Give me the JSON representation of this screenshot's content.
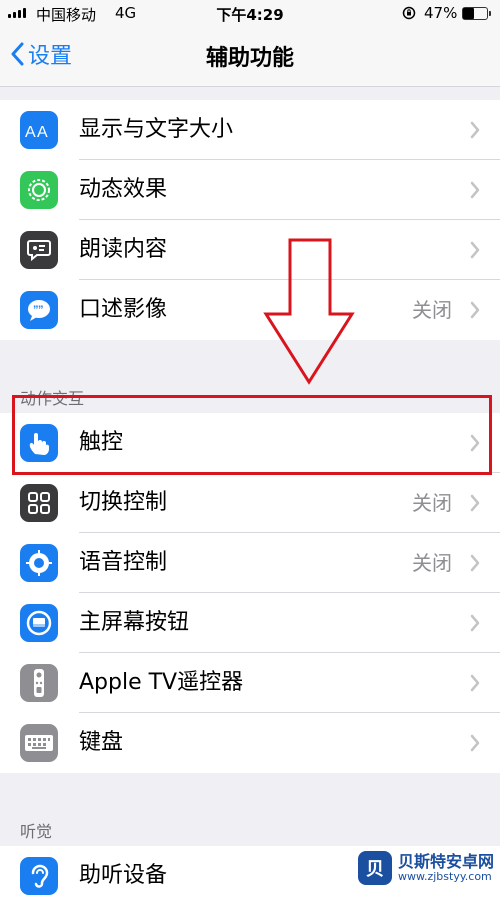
{
  "status_bar": {
    "carrier": "中国移动",
    "network": "4G",
    "time": "下午4:29",
    "battery": "47%",
    "battery_level": 0.47
  },
  "nav": {
    "back_label": "设置",
    "title": "辅助功能"
  },
  "vision": {
    "items": [
      {
        "label": "显示与文字大小",
        "value": "",
        "icon": "text-size-icon",
        "color": "#1a7ef0"
      },
      {
        "label": "动态效果",
        "value": "",
        "icon": "motion-icon",
        "color": "#33c759"
      },
      {
        "label": "朗读内容",
        "value": "",
        "icon": "spoken-content-icon",
        "color": "#3a3a3c"
      },
      {
        "label": "口述影像",
        "value": "关闭",
        "icon": "audio-description-icon",
        "color": "#1a7ef0"
      }
    ]
  },
  "interaction": {
    "header": "动作交互",
    "items": [
      {
        "label": "触控",
        "value": "",
        "icon": "touch-icon",
        "color": "#1a7ef0"
      },
      {
        "label": "切换控制",
        "value": "关闭",
        "icon": "switch-control-icon",
        "color": "#3a3a3c"
      },
      {
        "label": "语音控制",
        "value": "关闭",
        "icon": "voice-control-icon",
        "color": "#1a7ef0"
      },
      {
        "label": "主屏幕按钮",
        "value": "",
        "icon": "home-button-icon",
        "color": "#1a7ef0"
      },
      {
        "label": "Apple TV遥控器",
        "value": "",
        "icon": "remote-icon",
        "color": "#8e8e93"
      },
      {
        "label": "键盘",
        "value": "",
        "icon": "keyboard-icon",
        "color": "#8e8e93"
      }
    ]
  },
  "hearing": {
    "header": "听觉",
    "items": [
      {
        "label": "助听设备",
        "value": "",
        "icon": "hearing-icon",
        "color": "#1a7ef0"
      }
    ]
  },
  "watermark": {
    "badge": "贝",
    "name": "贝斯特安卓网",
    "url": "www.zjbstyy.com"
  },
  "colors": {
    "accent": "#1a7ef0",
    "highlight": "#d9141d"
  }
}
